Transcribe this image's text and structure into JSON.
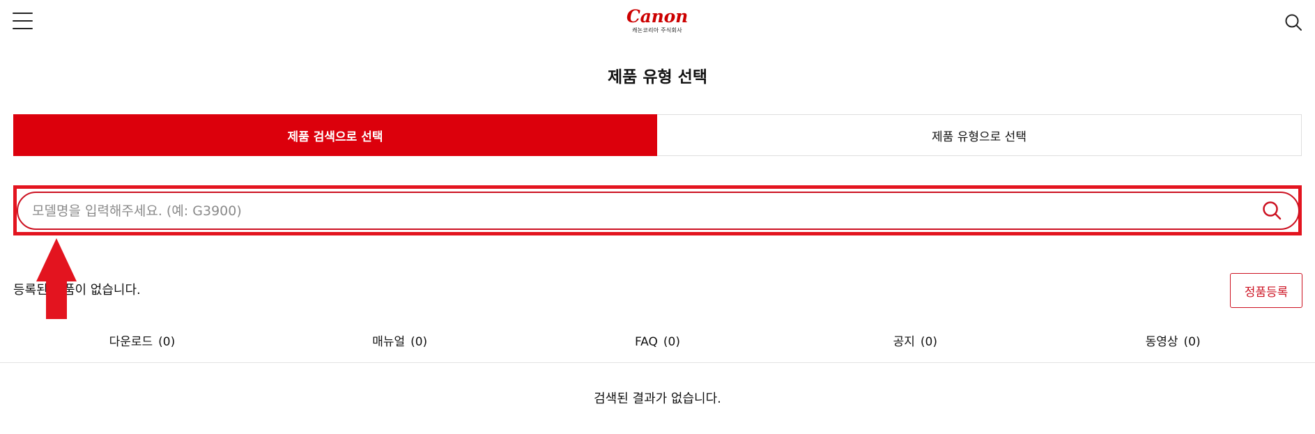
{
  "header": {
    "logo_text": "Canon",
    "logo_subtitle": "캐논코리아 주식회사",
    "menu_icon": "hamburger-menu-icon",
    "search_icon": "search-icon"
  },
  "page": {
    "title": "제품 유형 선택"
  },
  "tabs": [
    {
      "label": "제품 검색으로 선택",
      "active": true
    },
    {
      "label": "제품 유형으로 선택",
      "active": false
    }
  ],
  "search": {
    "value": "",
    "placeholder": "모델명을 입력해주세요. (예: G3900)",
    "submit_icon": "search-icon"
  },
  "registered": {
    "message": "등록된 제품이 없습니다.",
    "register_button": "정품등록"
  },
  "categories": [
    {
      "label": "다운로드",
      "count": "(0)"
    },
    {
      "label": "매뉴얼",
      "count": "(0)"
    },
    {
      "label": "FAQ",
      "count": "(0)"
    },
    {
      "label": "공지",
      "count": "(0)"
    },
    {
      "label": "동영상",
      "count": "(0)"
    }
  ],
  "results": {
    "empty_message": "검색된 결과가 없습니다."
  },
  "colors": {
    "accent": "#dc000c",
    "brand_red": "#cc0000",
    "highlight_annotation": "#e3141f"
  }
}
